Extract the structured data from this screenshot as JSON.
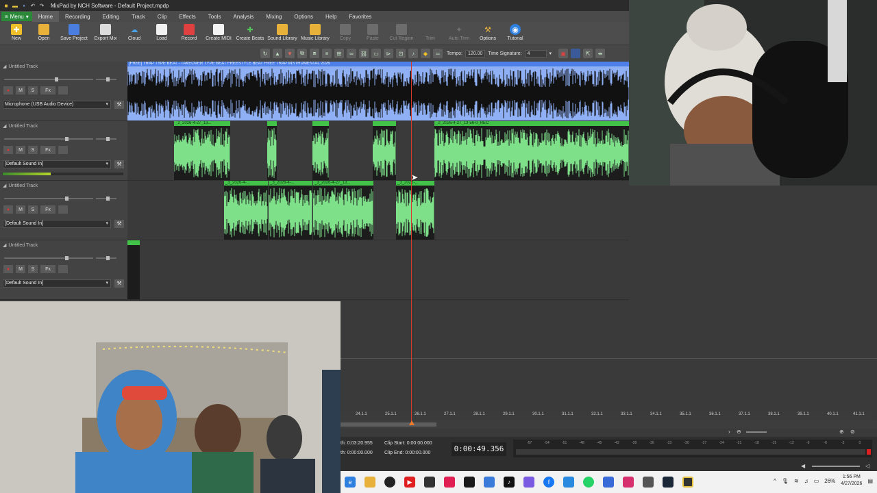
{
  "window": {
    "title": "MixPad by NCH Software - Default Project.mpdp"
  },
  "menu": {
    "menu_label": "Menu",
    "tabs": [
      "Home",
      "Recording",
      "Editing",
      "Track",
      "Clip",
      "Effects",
      "Tools",
      "Analysis",
      "Mixing",
      "Options",
      "Help",
      "Favorites"
    ]
  },
  "ribbon": {
    "buttons": [
      {
        "label": "New",
        "icon": "new-icon"
      },
      {
        "label": "Open",
        "icon": "folder-icon"
      },
      {
        "label": "Save Project",
        "icon": "save-icon"
      },
      {
        "label": "Export Mix",
        "icon": "export-icon"
      },
      {
        "label": "Cloud",
        "icon": "cloud-icon"
      },
      {
        "label": "Load",
        "icon": "load-icon"
      },
      {
        "label": "Record",
        "icon": "record-icon"
      },
      {
        "label": "Create MIDI",
        "icon": "midi-icon"
      },
      {
        "label": "Create Beats",
        "icon": "beats-icon"
      },
      {
        "label": "Sound Library",
        "icon": "sound-library-icon"
      },
      {
        "label": "Music Library",
        "icon": "music-library-icon"
      },
      {
        "label": "Copy",
        "icon": "copy-icon"
      },
      {
        "label": "Paste",
        "icon": "paste-icon"
      },
      {
        "label": "Cut Region",
        "icon": "cut-icon"
      },
      {
        "label": "Trim",
        "icon": "trim-icon"
      },
      {
        "label": "Auto Trim",
        "icon": "auto-trim-icon"
      },
      {
        "label": "Options",
        "icon": "options-icon"
      },
      {
        "label": "Tutorial",
        "icon": "tutorial-icon"
      }
    ]
  },
  "toolbar2": {
    "tempo_label": "Tempo:",
    "tempo_value": "120.00",
    "timesig_label": "Time Signature:",
    "timesig_value": "4"
  },
  "tracks": [
    {
      "name": "Untitled Track",
      "device": "Microphone (USB Audio Device)"
    },
    {
      "name": "Untitled Track",
      "device": "[Default Sound In]"
    },
    {
      "name": "Untitled Track",
      "device": "[Default Sound In]"
    },
    {
      "name": "Untitled Track",
      "device": "[Default Sound In]"
    }
  ],
  "track_controls": {
    "mute": "M",
    "solo": "S",
    "fx": "Fx"
  },
  "clips": {
    "beat": "[FREE] TRAP TYPE BEAT - TAKEOVER  TYPE BEAT  FREESTYLE BEAT  FREE TRAP INSTRUMENTAL 2026",
    "t2": [
      "_2_2026-4-27_13...",
      "",
      "",
      "",
      "_2_2026-4-27_13-56-0_REC"
    ],
    "t3": [
      "_3_2026-4-...",
      "_3_2026-4-...",
      "_3_2026-4-27_13...",
      "_3_2026-..."
    ]
  },
  "ruler": {
    "ticks": [
      "24.1.1",
      "25.1.1",
      "26.1.1",
      "27.1.1",
      "28.1.1",
      "29.1.1",
      "30.1.1",
      "31.1.1",
      "32.1.1",
      "33.1.1",
      "34.1.1",
      "35.1.1",
      "36.1.1",
      "37.1.1",
      "38.1.1",
      "39.1.1",
      "40.1.1",
      "41.1.1"
    ]
  },
  "status": {
    "length_label": "th:",
    "length_value": "0:03:20.955",
    "sel_label": "th:",
    "sel_value": "0:00:00.000",
    "clip_start_label": "Clip Start:",
    "clip_start_value": "0:00:00.000",
    "clip_end_label": "Clip End:",
    "clip_end_value": "0:00:00.000",
    "timer": "0:00:49.356",
    "level_ticks": [
      "-57",
      "-54",
      "-51",
      "-48",
      "-45",
      "-42",
      "-39",
      "-36",
      "-33",
      "-30",
      "-27",
      "-24",
      "-21",
      "-18",
      "-15",
      "-12",
      "-9",
      "-6",
      "-3",
      "0"
    ]
  },
  "taskbar": {
    "battery": "26%",
    "time": "1:56 PM",
    "date": "4/27/2026"
  },
  "colors": {
    "clip_green": "#43c24a",
    "beat_blue": "#8fb0f4",
    "playhead": "#d63a2a"
  }
}
